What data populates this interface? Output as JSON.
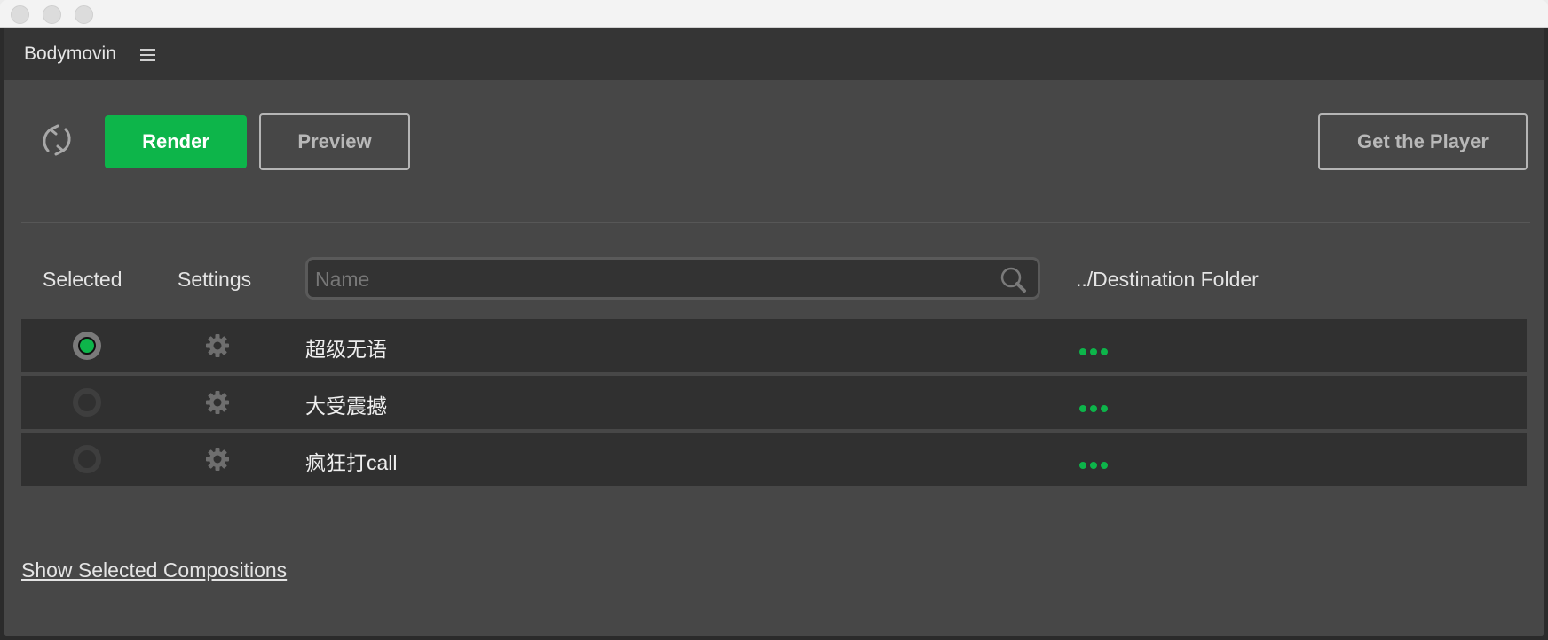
{
  "window": {
    "title_bar_buttons": [
      "close",
      "minimize",
      "zoom"
    ]
  },
  "panel": {
    "title": "Bodymovin",
    "menu_icon": "hamburger-icon"
  },
  "toolbar": {
    "refresh_icon": "refresh-icon",
    "render_label": "Render",
    "preview_label": "Preview",
    "get_player_label": "Get the Player"
  },
  "table": {
    "headers": {
      "selected": "Selected",
      "settings": "Settings",
      "destination": "../Destination Folder"
    },
    "search": {
      "placeholder": "Name",
      "value": ""
    },
    "rows": [
      {
        "name": "超级无语",
        "selected": true,
        "destination": "..."
      },
      {
        "name": "大受震撼",
        "selected": false,
        "destination": "..."
      },
      {
        "name": "疯狂打call",
        "selected": false,
        "destination": "..."
      }
    ]
  },
  "footer": {
    "show_selected_label": "Show Selected Compositions"
  },
  "colors": {
    "accent": "#0db54a",
    "panel_bg": "#474747",
    "row_bg": "#303030"
  }
}
